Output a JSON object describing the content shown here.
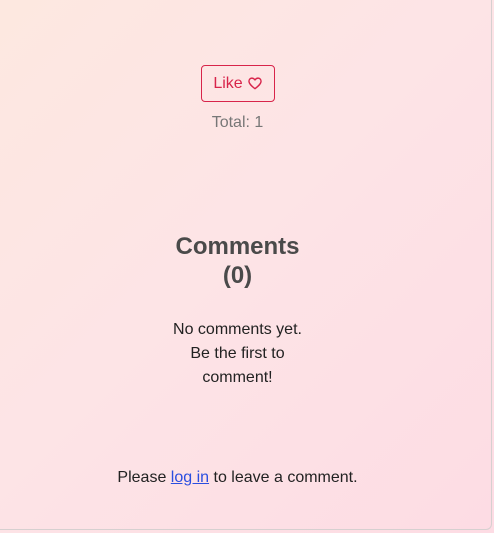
{
  "like": {
    "label": "Like",
    "icon": "heart-outline-icon",
    "accent_color": "#d8244a",
    "total_label": "Total: 1"
  },
  "comments": {
    "title_line1": "Comments",
    "title_line2": "(0)",
    "empty_line1": "No comments yet.",
    "empty_line2": "Be the first to",
    "empty_line3": "comment!"
  },
  "login": {
    "prefix": "Please ",
    "link_text": "log in",
    "suffix": " to leave a comment.",
    "link_color": "#2a4ee0"
  }
}
